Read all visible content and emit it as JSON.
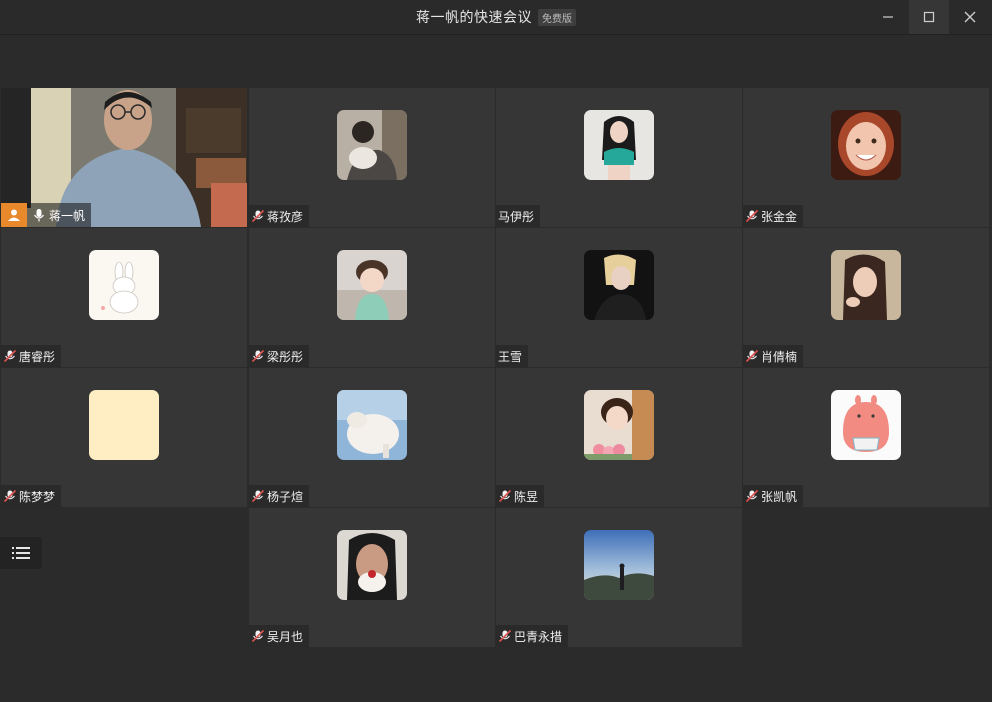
{
  "window": {
    "title": "蒋一帆的快速会议",
    "badge": "免费版"
  },
  "controls": {
    "minimize_icon": "minimize-icon",
    "maximize_icon": "maximize-icon",
    "close_icon": "close-icon"
  },
  "participants": [
    {
      "name": "蒋一帆",
      "is_self": true,
      "muted": false
    },
    {
      "name": "蒋孜彦",
      "muted": true
    },
    {
      "name": "马伊彤",
      "muted": false
    },
    {
      "name": "张金金",
      "muted": true
    },
    {
      "name": "唐睿彤",
      "muted": true
    },
    {
      "name": "梁彤彤",
      "muted": true
    },
    {
      "name": "王雪",
      "muted": false
    },
    {
      "name": "肖倩楠",
      "muted": true
    },
    {
      "name": "陈梦梦",
      "muted": true
    },
    {
      "name": "杨子煊",
      "muted": true
    },
    {
      "name": "陈昱",
      "muted": true
    },
    {
      "name": "张凯帆",
      "muted": true
    },
    {
      "name": "吴月也",
      "muted": true
    },
    {
      "name": "巴青永措",
      "muted": true
    }
  ],
  "colors": {
    "host_badge": "#e8892b",
    "mute_red": "#e0524f"
  }
}
